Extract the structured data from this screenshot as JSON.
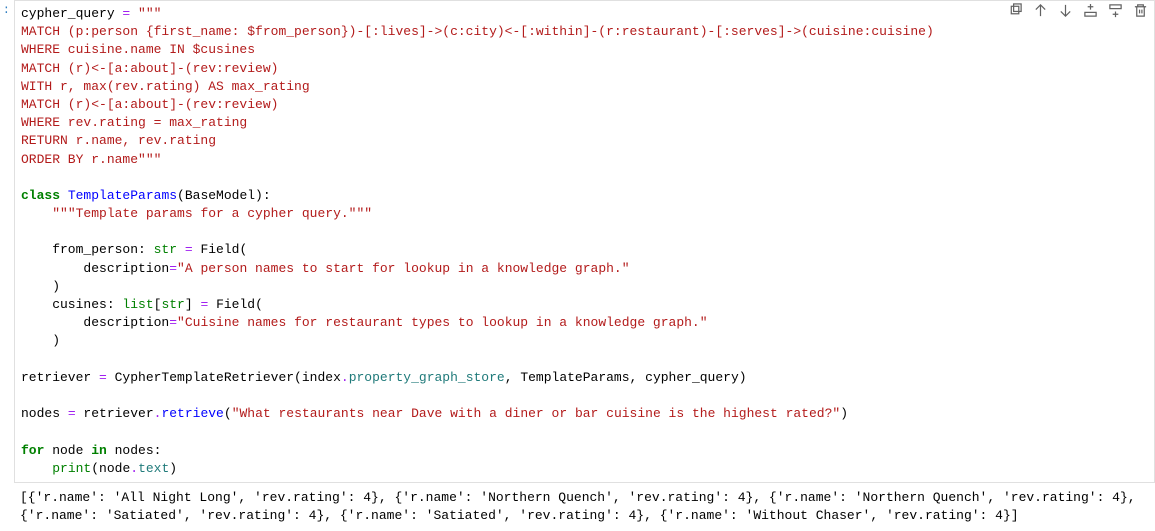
{
  "prompt": ":",
  "toolbar": {
    "duplicate": "Duplicate cell",
    "move_up": "Move cell up",
    "move_down": "Move cell down",
    "insert_above": "Insert cell above",
    "insert_below": "Insert cell below",
    "delete": "Delete cell"
  },
  "code": {
    "l01a": "cypher_query ",
    "l01b": "= ",
    "l01c": "\"\"\"",
    "l02": "MATCH (p:person {first_name: $from_person})-[:lives]->(c:city)<-[:within]-(r:restaurant)-[:serves]->(cuisine:cuisine)",
    "l03": "WHERE cuisine.name IN $cusines",
    "l04": "MATCH (r)<-[a:about]-(rev:review)",
    "l05": "WITH r, max(rev.rating) AS max_rating",
    "l06": "MATCH (r)<-[a:about]-(rev:review)",
    "l07": "WHERE rev.rating = max_rating",
    "l08": "RETURN r.name, rev.rating",
    "l09": "ORDER BY r.name\"\"\"",
    "l11a": "class",
    "l11b": " ",
    "l11c": "TemplateParams",
    "l11d": "(BaseModel):",
    "l12a": "    ",
    "l12b": "\"\"\"Template params for a cypher query.\"\"\"",
    "l14a": "    from_person: ",
    "l14b": "str",
    "l14c": " ",
    "l14d": "=",
    "l14e": " Field(",
    "l15a": "        description",
    "l15b": "=",
    "l15c": "\"A person names to start for lookup in a knowledge graph.\"",
    "l16": "    )",
    "l17a": "    cusines: ",
    "l17b": "list",
    "l17c": "[",
    "l17d": "str",
    "l17e": "] ",
    "l17f": "=",
    "l17g": " Field(",
    "l18a": "        description",
    "l18b": "=",
    "l18c": "\"Cuisine names for restaurant types to lookup in a knowledge graph.\"",
    "l19": "    )",
    "l21a": "retriever ",
    "l21b": "=",
    "l21c": " CypherTemplateRetriever(index",
    "l21d": ".",
    "l21e": "property_graph_store",
    "l21f": ", TemplateParams, cypher_query)",
    "l23a": "nodes ",
    "l23b": "=",
    "l23c": " retriever",
    "l23d": ".",
    "l23e": "retrieve",
    "l23f": "(",
    "l23g": "\"What restaurants near Dave with a diner or bar cuisine is the highest rated?\"",
    "l23h": ")",
    "l25a": "for",
    "l25b": " node ",
    "l25c": "in",
    "l25d": " nodes:",
    "l26a": "    ",
    "l26b": "print",
    "l26c": "(node",
    "l26d": ".",
    "l26e": "text",
    "l26f": ")"
  },
  "output": "[{'r.name': 'All Night Long', 'rev.rating': 4}, {'r.name': 'Northern Quench', 'rev.rating': 4}, {'r.name': 'Northern Quench', 'rev.rating': 4}, {'r.name': 'Satiated', 'rev.rating': 4}, {'r.name': 'Satiated', 'rev.rating': 4}, {'r.name': 'Without Chaser', 'rev.rating': 4}]"
}
